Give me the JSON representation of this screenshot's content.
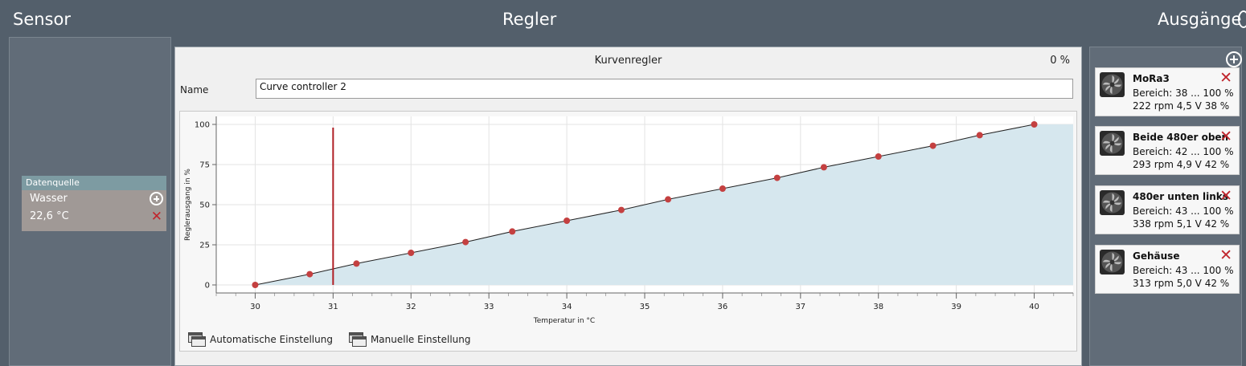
{
  "headers": {
    "sensor": "Sensor",
    "regler": "Regler",
    "ausgaenge": "Ausgänge"
  },
  "datasource": {
    "title": "Datenquelle",
    "name": "Wasser",
    "value": "22,6 °C",
    "add_icon": "plus-circle-icon",
    "remove_icon": "close-icon"
  },
  "controller": {
    "title": "Kurvenregler",
    "percent": "0 %",
    "name_label": "Name",
    "name_value": "Curve controller 2",
    "auto_button": "Automatische Einstellung",
    "manual_button": "Manuelle Einstellung"
  },
  "outputs": [
    {
      "name": "MoRa3",
      "range": "Bereich:  38 ... 100  %",
      "stats": "222 rpm  4,5 V  38 %"
    },
    {
      "name": "Beide 480er oben",
      "range": "Bereich:  42 ... 100  %",
      "stats": "293 rpm  4,9 V  42 %"
    },
    {
      "name": "480er unten links",
      "range": "Bereich:  43 ... 100  %",
      "stats": "338 rpm  5,1 V  42 %"
    },
    {
      "name": "Gehäuse",
      "range": "Bereich:  43 ... 100  %",
      "stats": "313 rpm  5,0 V  42 %"
    }
  ],
  "colors": {
    "accent_red": "#c0262d",
    "area_fill": "#d6e7ee",
    "marker": "#c44040"
  },
  "chart_data": {
    "type": "line",
    "xlabel": "Temperatur in °C",
    "ylabel": "Reglerausgang in %",
    "xlim": [
      29.5,
      40.5
    ],
    "ylim": [
      -5,
      105
    ],
    "xticks": [
      30,
      31,
      32,
      33,
      34,
      35,
      36,
      37,
      38,
      39,
      40
    ],
    "yticks": [
      0,
      25,
      50,
      75,
      100
    ],
    "grid": true,
    "current_value_line": 31,
    "series": [
      {
        "x": [
          30,
          30.7,
          31.3,
          32,
          32.7,
          33.3,
          34,
          34.7,
          35.3,
          36,
          36.7,
          37.3,
          38,
          38.7,
          39.3,
          40
        ],
        "y": [
          0,
          6.7,
          13.3,
          20,
          26.7,
          33.3,
          40,
          46.7,
          53.3,
          60,
          66.7,
          73.3,
          80,
          86.7,
          93.3,
          100
        ]
      }
    ]
  }
}
